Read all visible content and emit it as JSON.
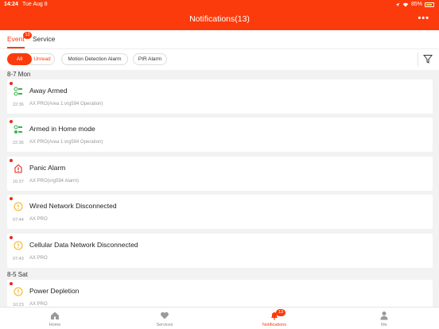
{
  "status_bar": {
    "time": "14:24",
    "date": "Tue Aug 8",
    "battery": "85%"
  },
  "header": {
    "title": "Notifications(13)",
    "more": "•••"
  },
  "tabs": [
    {
      "label": "Event",
      "badge": "13",
      "active": true
    },
    {
      "label": "Service",
      "active": false
    }
  ],
  "filters": [
    {
      "label": "All",
      "active": true
    },
    {
      "label": "Unread"
    },
    {
      "label": "Motion Detection Alarm"
    },
    {
      "label": "PIR Alarm"
    }
  ],
  "groups": [
    {
      "date": "8-7 Mon",
      "items": [
        {
          "title": "Away Armed",
          "time": "22:36",
          "subtitle": "AX PRO(Area 1:vrg594 Operation)",
          "icon": "away-armed-icon",
          "unread": true
        },
        {
          "title": "Armed in Home mode",
          "time": "22:36",
          "subtitle": "AX PRO(Area 1:vrg594 Operation)",
          "icon": "home-armed-icon",
          "unread": true
        },
        {
          "title": "Panic Alarm",
          "time": "16:37",
          "subtitle": "AX PRO(vrg594 Alarm)",
          "icon": "panic-alarm-icon",
          "unread": true
        },
        {
          "title": "Wired Network Disconnected",
          "time": "07:44",
          "subtitle": "AX PRO",
          "icon": "warning-icon",
          "unread": true
        },
        {
          "title": "Cellular Data Network Disconnected",
          "time": "07:43",
          "subtitle": "AX PRO",
          "icon": "warning-icon",
          "unread": true
        }
      ]
    },
    {
      "date": "8-5 Sat",
      "items": [
        {
          "title": "Power Depletion",
          "time": "10:23",
          "subtitle": "AX PRO",
          "icon": "warning-icon",
          "unread": true
        }
      ]
    }
  ],
  "bottom_nav": [
    {
      "label": "Home",
      "icon": "home-icon"
    },
    {
      "label": "Services",
      "icon": "heart-icon"
    },
    {
      "label": "Notifications",
      "icon": "bell-icon",
      "badge": "13",
      "active": true
    },
    {
      "label": "Me",
      "icon": "person-icon"
    }
  ],
  "colors": {
    "accent": "#fb3b0c",
    "unread_dot": "#e8291c",
    "arm_icon": "#3bb54a",
    "alarm_icon": "#e8291c",
    "warning_icon": "#f2b62b"
  }
}
